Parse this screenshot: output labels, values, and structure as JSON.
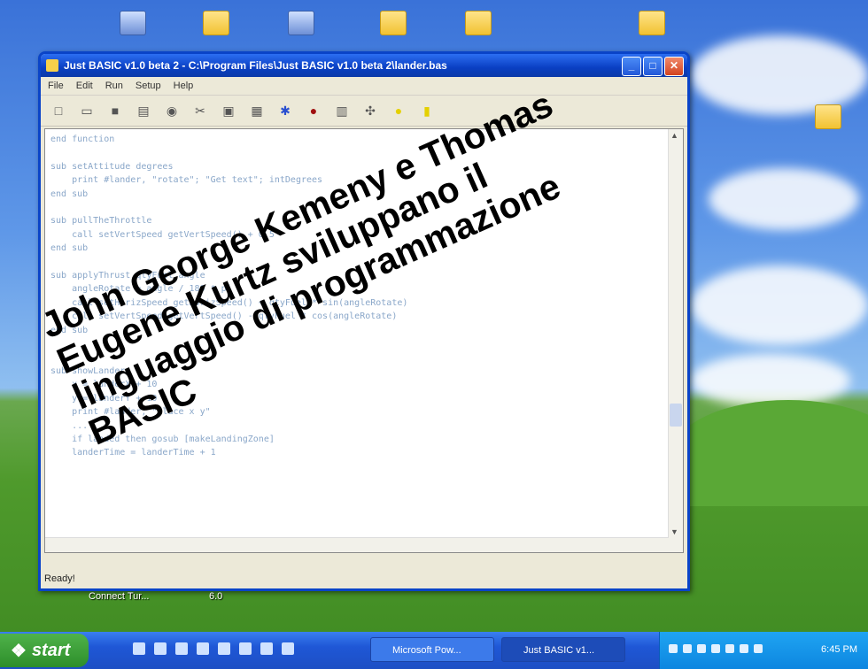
{
  "window": {
    "title": "Just BASIC v1.0 beta 2 - C:\\Program Files\\Just BASIC v1.0 beta 2\\lander.bas",
    "menu": [
      "File",
      "Edit",
      "Run",
      "Setup",
      "Help"
    ],
    "status": "Ready!"
  },
  "code": "end function\n\nsub setAttitude degrees\n    print #lander, \"rotate\"; \"Get text\"; intDegrees\nend sub\n\nsub pullTheThrottle\n    call setVertSpeed getVertSpeed() + 0.5\nend sub\n\nsub applyThrust qtyFuel angle\n    angleRotate = angle / 180 * pi\n    call setHorizSpeed getHorizSpeed() + qtyFuel * sin(angleRotate)\n    call setVertSpeed getVertSpeed() - qtyFuel * cos(angleRotate)\nend sub\n\n\nsub showLander\n    x = landerX + 10\n    y = landerY + 10\n    print #lander, \"place x y\"\n    ...\n    if landed then gosub [makeLandingZone]\n    landerTime = landerTime + 1\n",
  "overlay": {
    "line1": "John George Kemeny e Thomas",
    "line2": "Eugene Kurtz sviluppano il",
    "line3": "linguaggio di programmazione",
    "line4": "BASIC"
  },
  "desktop_label": "Connect Tur...",
  "desktop_label2": "6.0",
  "taskbar": {
    "start_label": "start",
    "tasks": [
      "Microsoft Pow...",
      "Just BASIC v1..."
    ],
    "clock": "6:45 PM"
  }
}
